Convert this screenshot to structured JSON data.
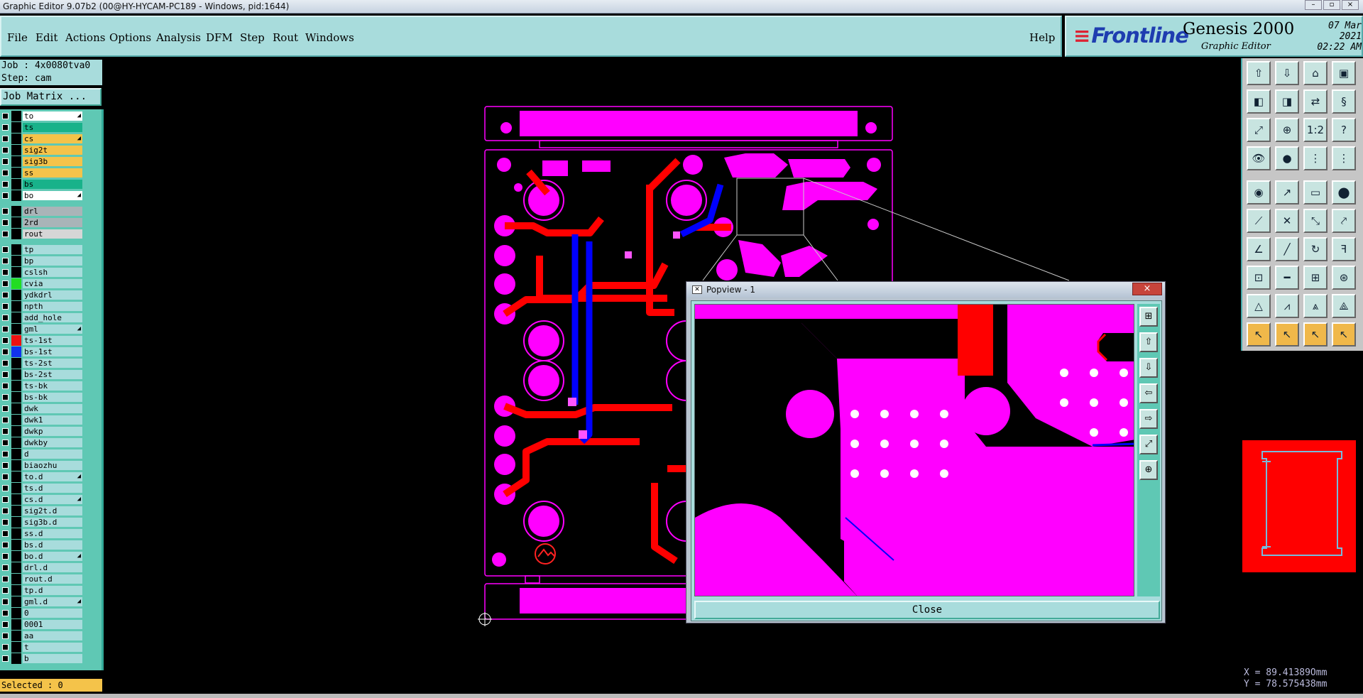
{
  "window": {
    "title": "Graphic Editor 9.07b2 (00@HY-HYCAM-PC189 - Windows, pid:1644)",
    "controls": [
      "–",
      "▫",
      "×"
    ]
  },
  "menu": {
    "items": [
      "File",
      "Edit",
      "Actions",
      "Options",
      "Analysis",
      "DFM",
      "Step",
      "Rout",
      "Windows"
    ],
    "help": "Help"
  },
  "brand": {
    "logo": "Frontline",
    "product": "Genesis 2000",
    "subtitle": "Graphic Editor",
    "date": "07 Mar 2021",
    "time": "02:22 AM"
  },
  "job": {
    "job_line": "Job : 4x0080tva0",
    "step_line": "Step: cam",
    "matrix_button": "Job Matrix ..."
  },
  "layers": [
    {
      "name": "to",
      "color": "#ffffff",
      "arrow": true,
      "swatch": "#000000"
    },
    {
      "name": "ts",
      "color": "#18b28a",
      "arrow": false,
      "swatch": "#000000"
    },
    {
      "name": "cs",
      "color": "#f4c34a",
      "arrow": true,
      "swatch": "#000000"
    },
    {
      "name": "sig2t",
      "color": "#f4c34a",
      "arrow": false,
      "swatch": "#000000"
    },
    {
      "name": "sig3b",
      "color": "#f4c34a",
      "arrow": false,
      "swatch": "#000000"
    },
    {
      "name": "ss",
      "color": "#f4c34a",
      "arrow": false,
      "swatch": "#000000"
    },
    {
      "name": "bs",
      "color": "#18b28a",
      "arrow": false,
      "swatch": "#000000"
    },
    {
      "name": "bo",
      "color": "#ffffff",
      "arrow": true,
      "swatch": "#000000"
    },
    {
      "name": "drl",
      "color": "#a9b4b8",
      "arrow": false,
      "swatch": "#000000"
    },
    {
      "name": "2rd",
      "color": "#a9b4b8",
      "arrow": false,
      "swatch": "#000000"
    },
    {
      "name": "rout",
      "color": "#d6d6d6",
      "arrow": false,
      "swatch": "#000000"
    },
    {
      "name": "tp",
      "color": "#a8dcdc",
      "arrow": false,
      "swatch": "#000000"
    },
    {
      "name": "bp",
      "color": "#a8dcdc",
      "arrow": false,
      "swatch": "#000000"
    },
    {
      "name": "cslsh",
      "color": "#a8dcdc",
      "arrow": false,
      "swatch": "#000000"
    },
    {
      "name": "cvia",
      "color": "#a8dcdc",
      "arrow": false,
      "swatch": "#22dd22"
    },
    {
      "name": "ydkdrl",
      "color": "#a8dcdc",
      "arrow": false,
      "swatch": "#000000"
    },
    {
      "name": "npth",
      "color": "#a8dcdc",
      "arrow": false,
      "swatch": "#000000"
    },
    {
      "name": "add_hole",
      "color": "#a8dcdc",
      "arrow": false,
      "swatch": "#000000"
    },
    {
      "name": "gml",
      "color": "#a8dcdc",
      "arrow": true,
      "swatch": "#000000"
    },
    {
      "name": "ts-1st",
      "color": "#a8dcdc",
      "arrow": false,
      "swatch": "#ee1111"
    },
    {
      "name": "bs-1st",
      "color": "#a8dcdc",
      "arrow": false,
      "swatch": "#1133ee"
    },
    {
      "name": "ts-2st",
      "color": "#a8dcdc",
      "arrow": false,
      "swatch": "#000000"
    },
    {
      "name": "bs-2st",
      "color": "#a8dcdc",
      "arrow": false,
      "swatch": "#000000"
    },
    {
      "name": "ts-bk",
      "color": "#a8dcdc",
      "arrow": false,
      "swatch": "#000000"
    },
    {
      "name": "bs-bk",
      "color": "#a8dcdc",
      "arrow": false,
      "swatch": "#000000"
    },
    {
      "name": "dwk",
      "color": "#a8dcdc",
      "arrow": false,
      "swatch": "#000000"
    },
    {
      "name": "dwk1",
      "color": "#a8dcdc",
      "arrow": false,
      "swatch": "#000000"
    },
    {
      "name": "dwkp",
      "color": "#a8dcdc",
      "arrow": false,
      "swatch": "#000000"
    },
    {
      "name": "dwkby",
      "color": "#a8dcdc",
      "arrow": false,
      "swatch": "#000000"
    },
    {
      "name": "d",
      "color": "#a8dcdc",
      "arrow": false,
      "swatch": "#000000"
    },
    {
      "name": "biaozhu",
      "color": "#a8dcdc",
      "arrow": false,
      "swatch": "#000000"
    },
    {
      "name": "to.d",
      "color": "#a8dcdc",
      "arrow": true,
      "swatch": "#000000"
    },
    {
      "name": "ts.d",
      "color": "#a8dcdc",
      "arrow": false,
      "swatch": "#000000"
    },
    {
      "name": "cs.d",
      "color": "#a8dcdc",
      "arrow": true,
      "swatch": "#000000"
    },
    {
      "name": "sig2t.d",
      "color": "#a8dcdc",
      "arrow": false,
      "swatch": "#000000"
    },
    {
      "name": "sig3b.d",
      "color": "#a8dcdc",
      "arrow": false,
      "swatch": "#000000"
    },
    {
      "name": "ss.d",
      "color": "#a8dcdc",
      "arrow": false,
      "swatch": "#000000"
    },
    {
      "name": "bs.d",
      "color": "#a8dcdc",
      "arrow": false,
      "swatch": "#000000"
    },
    {
      "name": "bo.d",
      "color": "#a8dcdc",
      "arrow": true,
      "swatch": "#000000"
    },
    {
      "name": "drl.d",
      "color": "#a8dcdc",
      "arrow": false,
      "swatch": "#000000"
    },
    {
      "name": "rout.d",
      "color": "#a8dcdc",
      "arrow": false,
      "swatch": "#000000"
    },
    {
      "name": "tp.d",
      "color": "#a8dcdc",
      "arrow": false,
      "swatch": "#000000"
    },
    {
      "name": "gml.d",
      "color": "#a8dcdc",
      "arrow": true,
      "swatch": "#000000"
    },
    {
      "name": "0",
      "color": "#a8dcdc",
      "arrow": false,
      "swatch": "#000000"
    },
    {
      "name": "0001",
      "color": "#a8dcdc",
      "arrow": false,
      "swatch": "#000000"
    },
    {
      "name": "aa",
      "color": "#a8dcdc",
      "arrow": false,
      "swatch": "#000000"
    },
    {
      "name": "t",
      "color": "#a8dcdc",
      "arrow": false,
      "swatch": "#000000"
    },
    {
      "name": "b",
      "color": "#a8dcdc",
      "arrow": false,
      "swatch": "#000000"
    }
  ],
  "status": {
    "selected": "Selected : 0"
  },
  "coords": {
    "x": "X =  89.41389Omm",
    "y": "Y =  78.575438mm"
  },
  "toolbar": {
    "buttons": [
      {
        "icon": "copy-layer-up-icon",
        "glyph": "⇧"
      },
      {
        "icon": "copy-layer-down-icon",
        "glyph": "⇩"
      },
      {
        "icon": "home-icon",
        "glyph": "⌂"
      },
      {
        "icon": "window-icon",
        "glyph": "▣"
      },
      {
        "icon": "pan-left-icon",
        "glyph": "◧"
      },
      {
        "icon": "pan-right-icon",
        "glyph": "◨"
      },
      {
        "icon": "mirror-icon",
        "glyph": "⇄"
      },
      {
        "icon": "snap-icon",
        "glyph": "§"
      },
      {
        "icon": "zoom-fit-icon",
        "glyph": "⤢"
      },
      {
        "icon": "zoom-center-icon",
        "glyph": "⊕"
      },
      {
        "icon": "scale-icon",
        "glyph": "1:2"
      },
      {
        "icon": "help-icon",
        "glyph": "?"
      },
      {
        "icon": "eye-icon",
        "glyph": "👁"
      },
      {
        "icon": "pad-icon",
        "glyph": "●"
      },
      {
        "icon": "net-icon",
        "glyph": "⋮"
      },
      {
        "icon": "net2-icon",
        "glyph": "⋮"
      },
      {
        "icon": "circle-fill-icon",
        "glyph": "◉"
      },
      {
        "icon": "measure-icon",
        "glyph": "↗"
      },
      {
        "icon": "ruler-icon",
        "glyph": "▭"
      },
      {
        "icon": "dot-icon",
        "glyph": "⬤"
      },
      {
        "icon": "route-icon",
        "glyph": "⟋"
      },
      {
        "icon": "cross-icon",
        "glyph": "✕"
      },
      {
        "icon": "connect-icon",
        "glyph": "⤡"
      },
      {
        "icon": "link-icon",
        "glyph": "⤤"
      },
      {
        "icon": "angle-icon",
        "glyph": "∠"
      },
      {
        "icon": "line-icon",
        "glyph": "╱"
      },
      {
        "icon": "arc-icon",
        "glyph": "↻"
      },
      {
        "icon": "split-icon",
        "glyph": "ꟻ"
      },
      {
        "icon": "drill-icon",
        "glyph": "⊡"
      },
      {
        "icon": "dash-icon",
        "glyph": "━"
      },
      {
        "icon": "target-icon",
        "glyph": "⊞"
      },
      {
        "icon": "pair-icon",
        "glyph": "⊛"
      },
      {
        "icon": "tri1-icon",
        "glyph": "△"
      },
      {
        "icon": "tri2-icon",
        "glyph": "⩘"
      },
      {
        "icon": "tri3-icon",
        "glyph": "⩓"
      },
      {
        "icon": "tri4-icon",
        "glyph": "⟁"
      },
      {
        "icon": "pointer-icon",
        "glyph": "↖"
      },
      {
        "icon": "pointer2-icon",
        "glyph": "↖"
      },
      {
        "icon": "pointer3-icon",
        "glyph": "↖"
      },
      {
        "icon": "pointer4-icon",
        "glyph": "↖"
      }
    ]
  },
  "popview": {
    "title": "Popview - 1",
    "close_x": "×",
    "close_label": "Close",
    "tools": [
      "⊞",
      "⇧",
      "⇩",
      "⇦",
      "⇨",
      "⤢",
      "⊕"
    ]
  },
  "colors": {
    "copper_magenta": "#ff00ff",
    "trace_red": "#ff0000",
    "trace_blue": "#0000ff",
    "panel_cyan": "#a8dcdc",
    "selected_yellow": "#f4c34a"
  }
}
